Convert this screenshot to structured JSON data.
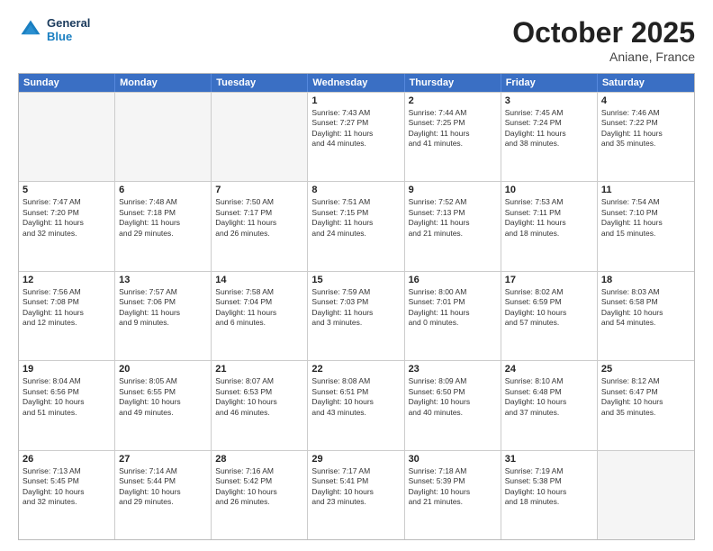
{
  "header": {
    "logo_line1": "General",
    "logo_line2": "Blue",
    "month": "October 2025",
    "location": "Aniane, France"
  },
  "weekdays": [
    "Sunday",
    "Monday",
    "Tuesday",
    "Wednesday",
    "Thursday",
    "Friday",
    "Saturday"
  ],
  "rows": [
    [
      {
        "day": "",
        "empty": true
      },
      {
        "day": "",
        "empty": true
      },
      {
        "day": "",
        "empty": true
      },
      {
        "day": "1",
        "lines": [
          "Sunrise: 7:43 AM",
          "Sunset: 7:27 PM",
          "Daylight: 11 hours",
          "and 44 minutes."
        ]
      },
      {
        "day": "2",
        "lines": [
          "Sunrise: 7:44 AM",
          "Sunset: 7:25 PM",
          "Daylight: 11 hours",
          "and 41 minutes."
        ]
      },
      {
        "day": "3",
        "lines": [
          "Sunrise: 7:45 AM",
          "Sunset: 7:24 PM",
          "Daylight: 11 hours",
          "and 38 minutes."
        ]
      },
      {
        "day": "4",
        "lines": [
          "Sunrise: 7:46 AM",
          "Sunset: 7:22 PM",
          "Daylight: 11 hours",
          "and 35 minutes."
        ]
      }
    ],
    [
      {
        "day": "5",
        "lines": [
          "Sunrise: 7:47 AM",
          "Sunset: 7:20 PM",
          "Daylight: 11 hours",
          "and 32 minutes."
        ]
      },
      {
        "day": "6",
        "lines": [
          "Sunrise: 7:48 AM",
          "Sunset: 7:18 PM",
          "Daylight: 11 hours",
          "and 29 minutes."
        ]
      },
      {
        "day": "7",
        "lines": [
          "Sunrise: 7:50 AM",
          "Sunset: 7:17 PM",
          "Daylight: 11 hours",
          "and 26 minutes."
        ]
      },
      {
        "day": "8",
        "lines": [
          "Sunrise: 7:51 AM",
          "Sunset: 7:15 PM",
          "Daylight: 11 hours",
          "and 24 minutes."
        ]
      },
      {
        "day": "9",
        "lines": [
          "Sunrise: 7:52 AM",
          "Sunset: 7:13 PM",
          "Daylight: 11 hours",
          "and 21 minutes."
        ]
      },
      {
        "day": "10",
        "lines": [
          "Sunrise: 7:53 AM",
          "Sunset: 7:11 PM",
          "Daylight: 11 hours",
          "and 18 minutes."
        ]
      },
      {
        "day": "11",
        "lines": [
          "Sunrise: 7:54 AM",
          "Sunset: 7:10 PM",
          "Daylight: 11 hours",
          "and 15 minutes."
        ]
      }
    ],
    [
      {
        "day": "12",
        "lines": [
          "Sunrise: 7:56 AM",
          "Sunset: 7:08 PM",
          "Daylight: 11 hours",
          "and 12 minutes."
        ]
      },
      {
        "day": "13",
        "lines": [
          "Sunrise: 7:57 AM",
          "Sunset: 7:06 PM",
          "Daylight: 11 hours",
          "and 9 minutes."
        ]
      },
      {
        "day": "14",
        "lines": [
          "Sunrise: 7:58 AM",
          "Sunset: 7:04 PM",
          "Daylight: 11 hours",
          "and 6 minutes."
        ]
      },
      {
        "day": "15",
        "lines": [
          "Sunrise: 7:59 AM",
          "Sunset: 7:03 PM",
          "Daylight: 11 hours",
          "and 3 minutes."
        ]
      },
      {
        "day": "16",
        "lines": [
          "Sunrise: 8:00 AM",
          "Sunset: 7:01 PM",
          "Daylight: 11 hours",
          "and 0 minutes."
        ]
      },
      {
        "day": "17",
        "lines": [
          "Sunrise: 8:02 AM",
          "Sunset: 6:59 PM",
          "Daylight: 10 hours",
          "and 57 minutes."
        ]
      },
      {
        "day": "18",
        "lines": [
          "Sunrise: 8:03 AM",
          "Sunset: 6:58 PM",
          "Daylight: 10 hours",
          "and 54 minutes."
        ]
      }
    ],
    [
      {
        "day": "19",
        "lines": [
          "Sunrise: 8:04 AM",
          "Sunset: 6:56 PM",
          "Daylight: 10 hours",
          "and 51 minutes."
        ]
      },
      {
        "day": "20",
        "lines": [
          "Sunrise: 8:05 AM",
          "Sunset: 6:55 PM",
          "Daylight: 10 hours",
          "and 49 minutes."
        ]
      },
      {
        "day": "21",
        "lines": [
          "Sunrise: 8:07 AM",
          "Sunset: 6:53 PM",
          "Daylight: 10 hours",
          "and 46 minutes."
        ]
      },
      {
        "day": "22",
        "lines": [
          "Sunrise: 8:08 AM",
          "Sunset: 6:51 PM",
          "Daylight: 10 hours",
          "and 43 minutes."
        ]
      },
      {
        "day": "23",
        "lines": [
          "Sunrise: 8:09 AM",
          "Sunset: 6:50 PM",
          "Daylight: 10 hours",
          "and 40 minutes."
        ]
      },
      {
        "day": "24",
        "lines": [
          "Sunrise: 8:10 AM",
          "Sunset: 6:48 PM",
          "Daylight: 10 hours",
          "and 37 minutes."
        ]
      },
      {
        "day": "25",
        "lines": [
          "Sunrise: 8:12 AM",
          "Sunset: 6:47 PM",
          "Daylight: 10 hours",
          "and 35 minutes."
        ]
      }
    ],
    [
      {
        "day": "26",
        "lines": [
          "Sunrise: 7:13 AM",
          "Sunset: 5:45 PM",
          "Daylight: 10 hours",
          "and 32 minutes."
        ]
      },
      {
        "day": "27",
        "lines": [
          "Sunrise: 7:14 AM",
          "Sunset: 5:44 PM",
          "Daylight: 10 hours",
          "and 29 minutes."
        ]
      },
      {
        "day": "28",
        "lines": [
          "Sunrise: 7:16 AM",
          "Sunset: 5:42 PM",
          "Daylight: 10 hours",
          "and 26 minutes."
        ]
      },
      {
        "day": "29",
        "lines": [
          "Sunrise: 7:17 AM",
          "Sunset: 5:41 PM",
          "Daylight: 10 hours",
          "and 23 minutes."
        ]
      },
      {
        "day": "30",
        "lines": [
          "Sunrise: 7:18 AM",
          "Sunset: 5:39 PM",
          "Daylight: 10 hours",
          "and 21 minutes."
        ]
      },
      {
        "day": "31",
        "lines": [
          "Sunrise: 7:19 AM",
          "Sunset: 5:38 PM",
          "Daylight: 10 hours",
          "and 18 minutes."
        ]
      },
      {
        "day": "",
        "empty": true
      }
    ]
  ]
}
